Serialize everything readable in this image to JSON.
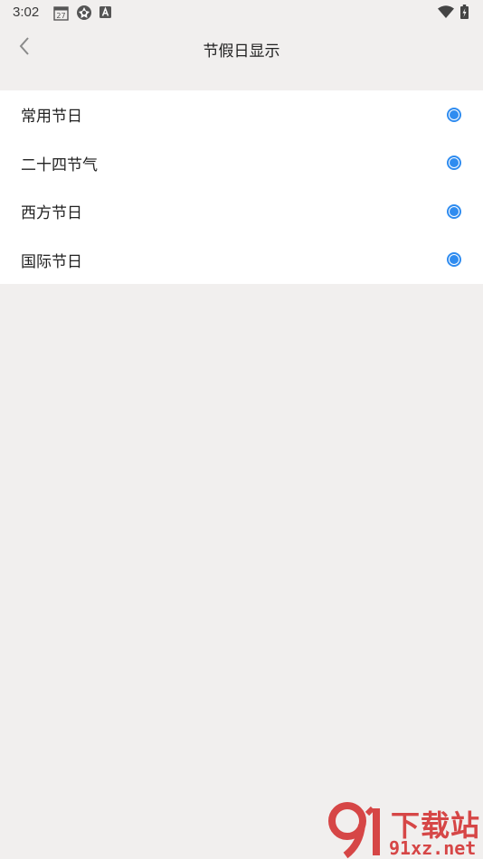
{
  "status_bar": {
    "time": "3:02",
    "calendar_day": "27",
    "icons": [
      "calendar-icon",
      "gear-icon",
      "a-badge-icon",
      "wifi-icon",
      "battery-icon"
    ]
  },
  "header": {
    "title": "节假日显示",
    "back_icon": "chevron-left-icon"
  },
  "options": [
    {
      "label": "常用节日",
      "selected": true
    },
    {
      "label": "二十四节气",
      "selected": true
    },
    {
      "label": "西方节日",
      "selected": true
    },
    {
      "label": "国际节日",
      "selected": true
    }
  ],
  "watermark": {
    "logo_text": "下载站",
    "domain": "91xz.net"
  },
  "colors": {
    "background": "#f1efee",
    "accent": "#2f8cf0",
    "watermark": "#d64646"
  }
}
